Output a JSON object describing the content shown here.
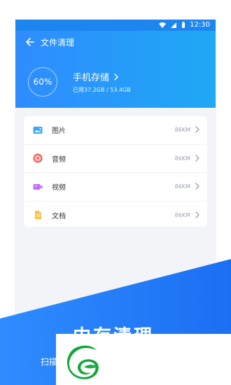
{
  "colors": {
    "header_start": "#2f8cff",
    "header_end": "#1fa8f4",
    "bottom_band": "#1a73f5",
    "logo_green": "#12a53a"
  },
  "status_bar": {
    "time": "12:30",
    "icons": [
      "wifi-icon",
      "signal-icon",
      "battery-icon"
    ]
  },
  "header": {
    "title": "文件清理",
    "back_icon": "arrow-left-icon"
  },
  "storage": {
    "percent": "60%",
    "title": "手机存储",
    "usage": "已用37.2GB / 53.4GB",
    "percent_value": 0.6
  },
  "categories": [
    {
      "label": "图片",
      "size": "86KM",
      "icon": "image-icon"
    },
    {
      "label": "音频",
      "size": "86KM",
      "icon": "audio-icon"
    },
    {
      "label": "视频",
      "size": "86KM",
      "icon": "video-icon"
    },
    {
      "label": "文档",
      "size": "86KM",
      "icon": "document-icon"
    }
  ],
  "promo": {
    "title": "内存清理",
    "subtitle": "扫描"
  },
  "logo": {
    "name": "green-leaf-g-logo"
  }
}
